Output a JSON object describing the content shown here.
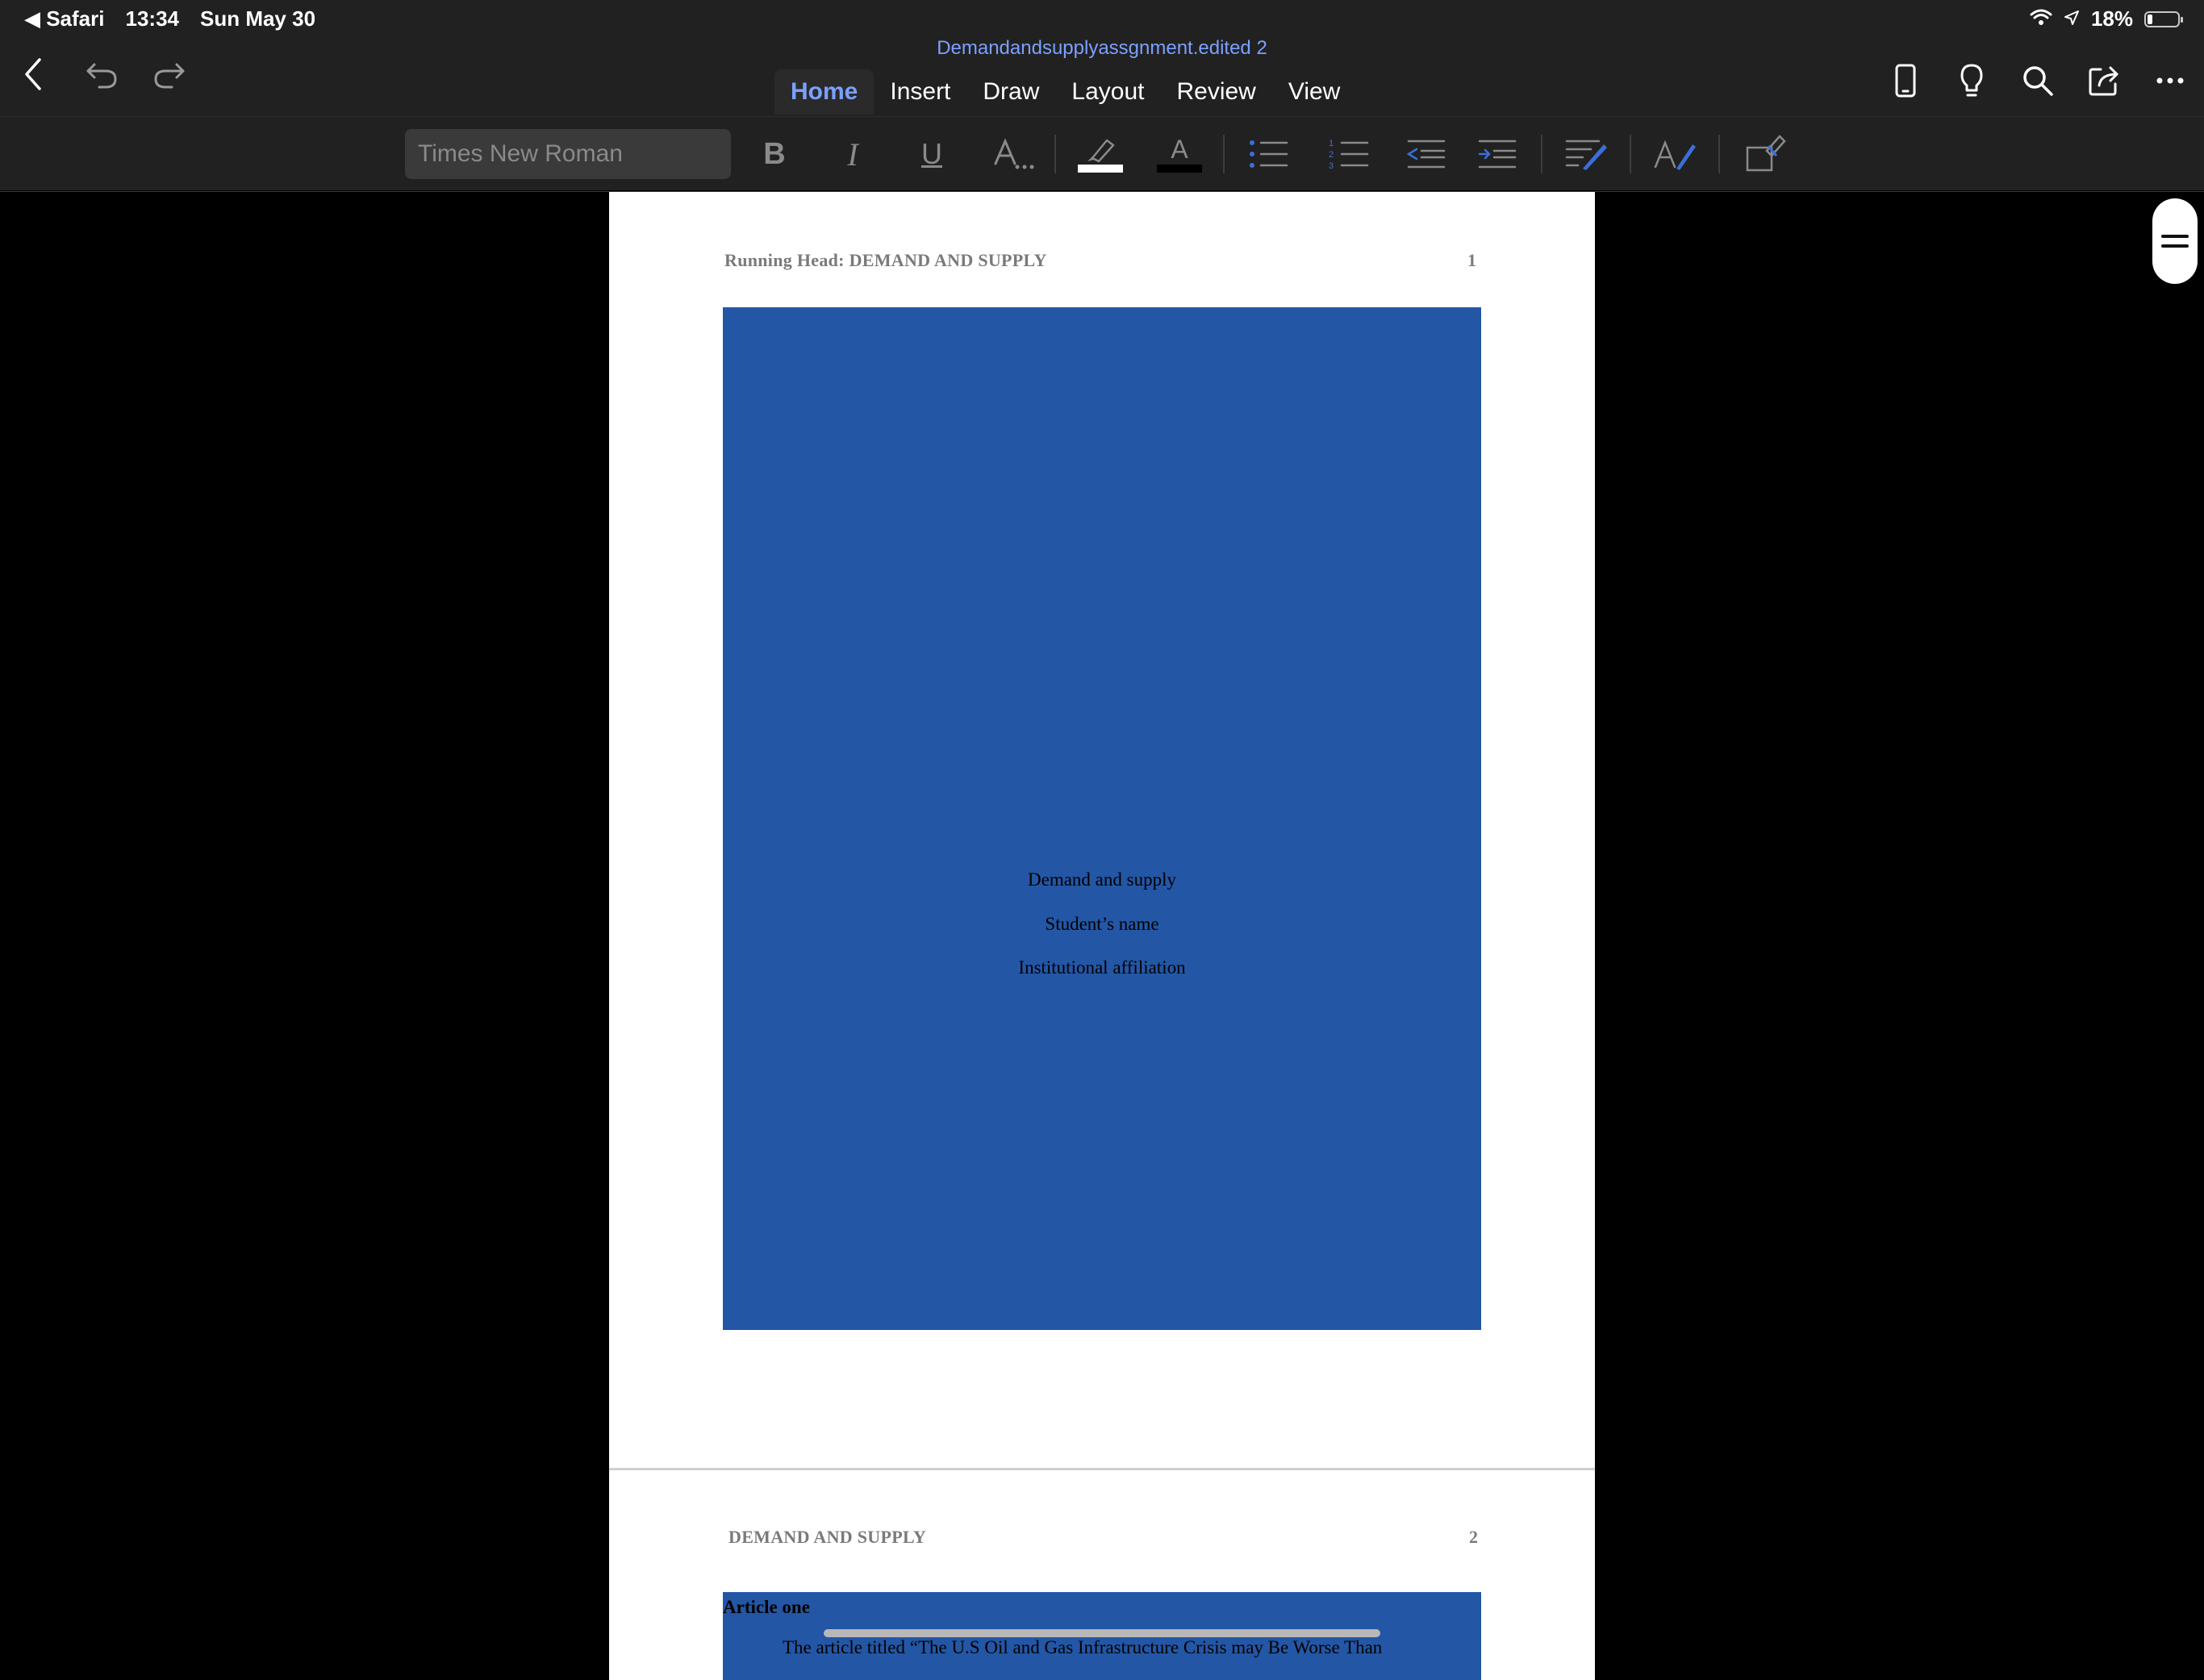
{
  "status_bar": {
    "back_app": "◀ Safari",
    "time": "13:34",
    "date": "Sun May 30",
    "battery": "18%",
    "battery_level": 0.18
  },
  "document": {
    "title": "Demandandsupplyassgnment.edited 2"
  },
  "tabs": [
    {
      "label": "Home",
      "active": true
    },
    {
      "label": "Insert",
      "active": false
    },
    {
      "label": "Draw",
      "active": false
    },
    {
      "label": "Layout",
      "active": false
    },
    {
      "label": "Review",
      "active": false
    },
    {
      "label": "View",
      "active": false
    }
  ],
  "toolbar": {
    "font_name": "Times New Roman",
    "highlight_color": "#ffffff",
    "font_color": "#000000"
  },
  "page1": {
    "running_head": "Running Head: DEMAND AND SUPPLY",
    "page_number": "1",
    "cover_lines": [
      "Demand and supply",
      "Student’s name",
      "Institutional affiliation"
    ],
    "cover_color": "#2356a5"
  },
  "page2": {
    "running_head": "DEMAND AND SUPPLY",
    "page_number": "2",
    "heading": "Article one",
    "body_start": "The article titled “The U.S Oil and Gas Infrastructure Crisis may Be Worse Than"
  },
  "colors": {
    "accent": "#7ba0ff",
    "chrome_bg": "#212121",
    "canvas_bg": "#000000"
  }
}
